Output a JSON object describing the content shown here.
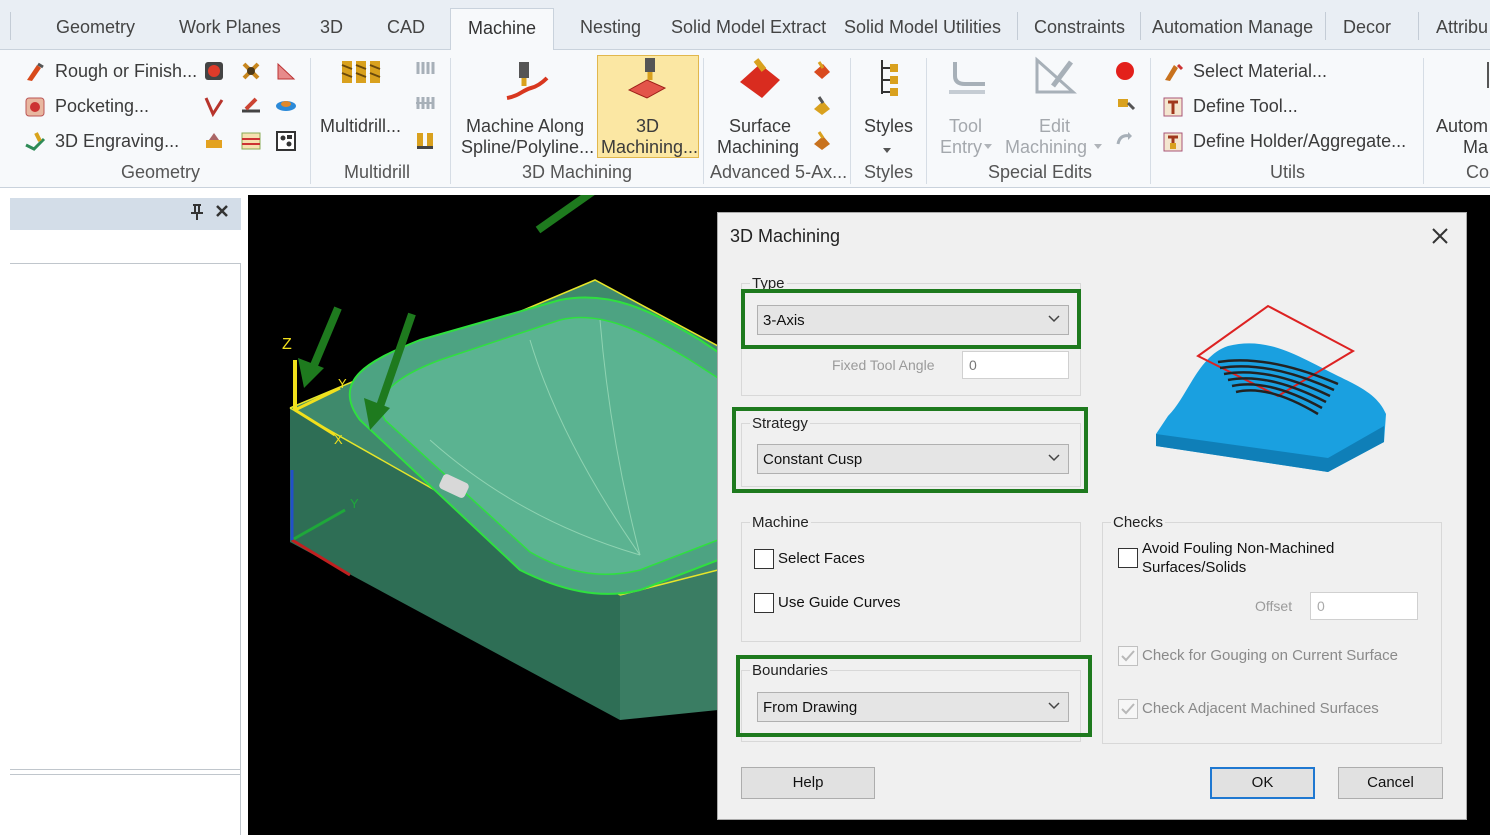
{
  "tabs": [
    {
      "label": "Geometry"
    },
    {
      "label": "Work Planes"
    },
    {
      "label": "3D"
    },
    {
      "label": "CAD"
    },
    {
      "label": "Machine"
    },
    {
      "label": "Nesting"
    },
    {
      "label": "Solid Model Extract"
    },
    {
      "label": "Solid Model Utilities"
    },
    {
      "label": "Constraints"
    },
    {
      "label": "Automation Manage"
    },
    {
      "label": "Decor"
    },
    {
      "label": "Attribu"
    }
  ],
  "active_tab": "Machine",
  "ribbon": {
    "geometry": {
      "rough": "Rough or Finish...",
      "pocketing": "Pocketing...",
      "engraving": "3D Engraving...",
      "group_label": "Geometry"
    },
    "multidrill": {
      "button": "Multidrill...",
      "group_label": "Multidrill"
    },
    "machining3d": {
      "along_line1": "Machine Along",
      "along_line2": "Spline/Polyline...",
      "mach_line1": "3D",
      "mach_line2": "Machining...",
      "group_label": "3D Machining"
    },
    "advanced": {
      "line1": "Surface",
      "line2": "Machining",
      "group_label": "Advanced 5-Ax..."
    },
    "styles": {
      "button": "Styles",
      "group_label": "Styles"
    },
    "special": {
      "tool_line1": "Tool",
      "tool_line2": "Entry",
      "edit_line1": "Edit",
      "edit_line2": "Machining",
      "group_label": "Special Edits"
    },
    "utils": {
      "material": "Select Material...",
      "tool": "Define Tool...",
      "holder": "Define Holder/Aggregate...",
      "group_label": "Utils"
    },
    "auto": {
      "line1": "Autom",
      "line2": "Ma",
      "group_label": "Co"
    }
  },
  "viewport": {
    "axis_z": "Z",
    "axis_y": "Y",
    "axis_x": "X",
    "axis_y2": "Y"
  },
  "dialog": {
    "title": "3D Machining",
    "type_label": "Type",
    "type_value": "3-Axis",
    "fixed_tool_angle_label": "Fixed Tool Angle",
    "fixed_tool_angle_value": "0",
    "strategy_label": "Strategy",
    "strategy_value": "Constant Cusp",
    "machine_label": "Machine",
    "select_faces": "Select Faces",
    "use_guide_curves": "Use Guide Curves",
    "boundaries_label": "Boundaries",
    "boundaries_value": "From Drawing",
    "checks_label": "Checks",
    "avoid_fouling_line1": "Avoid Fouling Non-Machined",
    "avoid_fouling_line2": "Surfaces/Solids",
    "offset_label": "Offset",
    "offset_value": "0",
    "check_gouging": "Check for Gouging on Current Surface",
    "check_adjacent": "Check Adjacent Machined Surfaces",
    "help": "Help",
    "ok": "OK",
    "cancel": "Cancel"
  },
  "colors": {
    "callout": "#1e7a1e",
    "highlight": "#fbe7a3",
    "model": "#3f8a6c",
    "preview": "#1aa0e0"
  }
}
